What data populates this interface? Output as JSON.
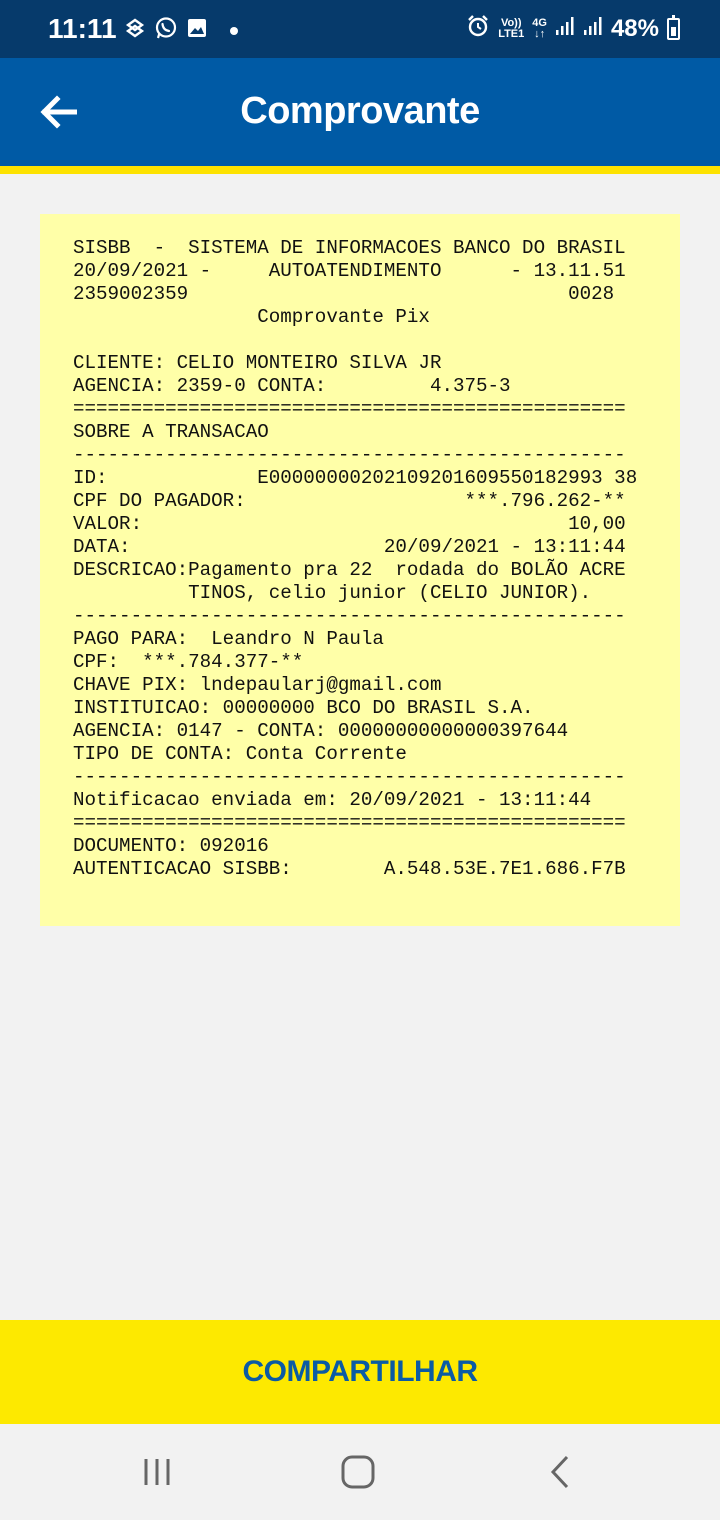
{
  "status_bar": {
    "time": "11:11",
    "volte": "Vo))",
    "lte": "LTE1",
    "network": "4G",
    "battery": "48%"
  },
  "app_bar": {
    "title": "Comprovante",
    "back_icon": "arrow-left-icon"
  },
  "receipt": {
    "lines": [
      "SISBB  -  SISTEMA DE INFORMACOES BANCO DO BRASIL",
      "20/09/2021 -     AUTOATENDIMENTO      - 13.11.51",
      "2359002359                                 0028",
      "                Comprovante Pix",
      "",
      "CLIENTE: CELIO MONTEIRO SILVA JR",
      "AGENCIA: 2359-0 CONTA:         4.375-3",
      "================================================",
      "SOBRE A TRANSACAO",
      "------------------------------------------------",
      "ID:             E00000000202109201609550182993 38",
      "CPF DO PAGADOR:                   ***.796.262-**",
      "VALOR:                                     10,00",
      "DATA:                      20/09/2021 - 13:11:44",
      "DESCRICAO:Pagamento pra 22  rodada do BOLÃO ACRE",
      "          TINOS, celio junior (CELIO JUNIOR).",
      "------------------------------------------------",
      "PAGO PARA:  Leandro N Paula",
      "CPF:  ***.784.377-**",
      "CHAVE PIX: lndepaularj@gmail.com",
      "INSTITUICAO: 00000000 BCO DO BRASIL S.A.",
      "AGENCIA: 0147 - CONTA: 00000000000000397644",
      "TIPO DE CONTA: Conta Corrente",
      "------------------------------------------------",
      "Notificacao enviada em: 20/09/2021 - 13:11:44",
      "================================================",
      "DOCUMENTO: 092016",
      "AUTENTICACAO SISBB:        A.548.53E.7E1.686.F7B"
    ]
  },
  "share_button": {
    "label": "COMPARTILHAR"
  },
  "nav_bar": {
    "recent_icon": "recent-apps-icon",
    "home_icon": "home-icon",
    "back_icon": "back-chevron-icon"
  },
  "colors": {
    "status_bar": "#063a6b",
    "app_bar": "#005aa5",
    "accent_yellow": "#fde200",
    "receipt_bg": "#ffffa8",
    "share_text": "#0b5ba4"
  }
}
